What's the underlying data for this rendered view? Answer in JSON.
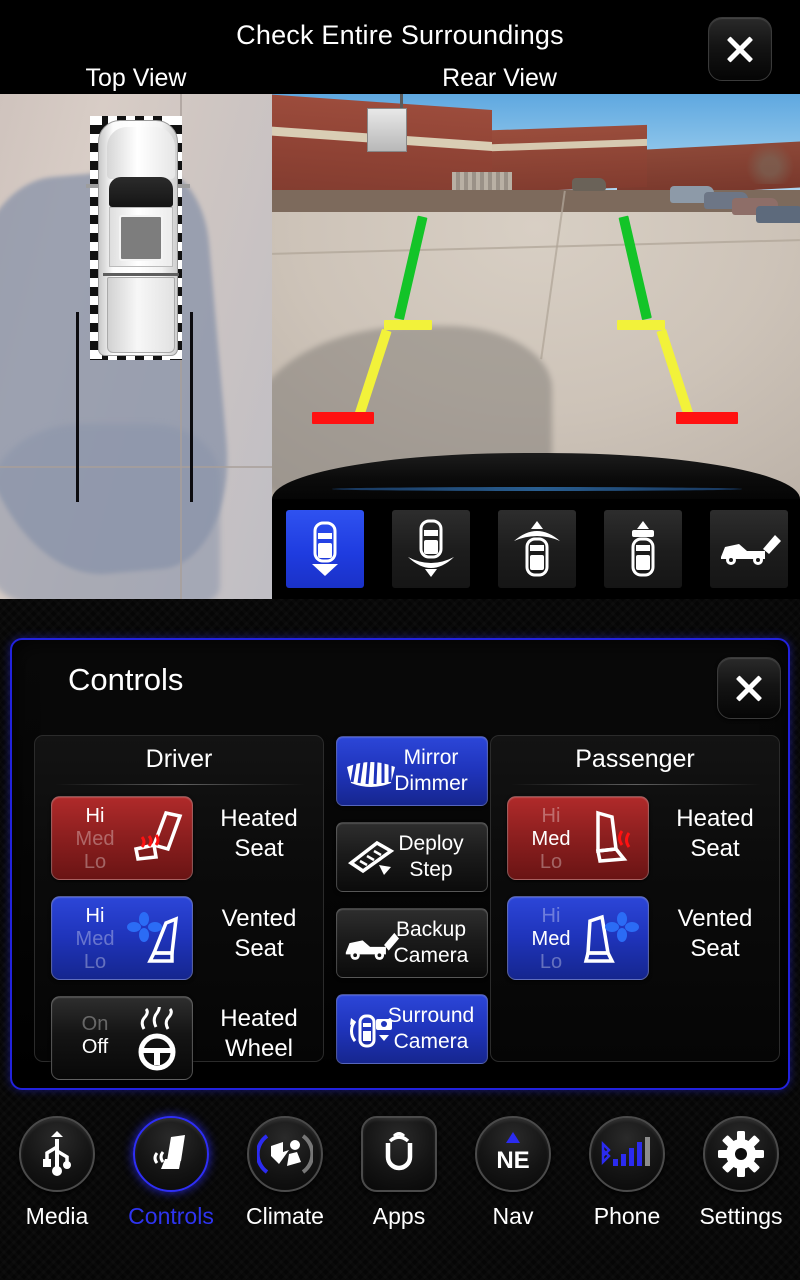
{
  "header": {
    "title": "Check Entire Surroundings",
    "top_view_label": "Top View",
    "rear_view_label": "Rear View",
    "close_label": "X"
  },
  "camera": {
    "guideline_colors": {
      "near": "#ff1111",
      "mid": "#f2f23a",
      "far": "#13c428"
    },
    "view_modes": [
      {
        "name": "rear-narrow-view",
        "selected": true
      },
      {
        "name": "rear-wide-view",
        "selected": false
      },
      {
        "name": "front-wide-view",
        "selected": false
      },
      {
        "name": "front-narrow-view",
        "selected": false
      },
      {
        "name": "cargo-bed-view",
        "selected": false
      }
    ],
    "selected_mode_index": 0
  },
  "controls": {
    "title": "Controls",
    "close_label": "X",
    "accent_color": "#2222dd",
    "driver": {
      "header": "Driver",
      "rows": [
        {
          "icon": "heated-seat-icon",
          "label": "Heated\nSeat",
          "label_line1": "Heated",
          "label_line2": "Seat",
          "levels": [
            "Hi",
            "Med",
            "Lo"
          ],
          "active_level": "Hi",
          "state": "heat"
        },
        {
          "icon": "vented-seat-icon",
          "label_line1": "Vented",
          "label_line2": "Seat",
          "levels": [
            "Hi",
            "Med",
            "Lo"
          ],
          "active_level": "Hi",
          "state": "vent"
        },
        {
          "icon": "heated-wheel-icon",
          "label_line1": "Heated",
          "label_line2": "Wheel",
          "levels": [
            "On",
            "Off"
          ],
          "active_level": "Off",
          "state": "wheel"
        }
      ]
    },
    "passenger": {
      "header": "Passenger",
      "rows": [
        {
          "icon": "heated-seat-icon",
          "label_line1": "Heated",
          "label_line2": "Seat",
          "levels": [
            "Hi",
            "Med",
            "Lo"
          ],
          "active_level": "Med",
          "state": "heat"
        },
        {
          "icon": "vented-seat-icon",
          "label_line1": "Vented",
          "label_line2": "Seat",
          "levels": [
            "Hi",
            "Med",
            "Lo"
          ],
          "active_level": "Med",
          "state": "vent"
        }
      ]
    },
    "middle_buttons": [
      {
        "icon": "mirror-dimmer-icon",
        "line1": "Mirror",
        "line2": "Dimmer",
        "active": true
      },
      {
        "icon": "deploy-step-icon",
        "line1": "Deploy",
        "line2": "Step",
        "active": false
      },
      {
        "icon": "backup-camera-icon",
        "line1": "Backup",
        "line2": "Camera",
        "active": false
      },
      {
        "icon": "surround-camera-icon",
        "line1": "Surround",
        "line2": "Camera",
        "active": true
      }
    ]
  },
  "navbar": {
    "items": [
      {
        "label": "Media",
        "icon": "usb-icon",
        "active": false
      },
      {
        "label": "Controls",
        "icon": "seat-icon",
        "active": true
      },
      {
        "label": "Climate",
        "icon": "climate-icon",
        "active": false
      },
      {
        "label": "Apps",
        "icon": "uconnect-icon",
        "active": false
      },
      {
        "label": "Nav",
        "icon": "compass-ne-icon",
        "active": false,
        "text": "NE"
      },
      {
        "label": "Phone",
        "icon": "signal-icon",
        "active": false
      },
      {
        "label": "Settings",
        "icon": "gear-icon",
        "active": false
      }
    ]
  }
}
